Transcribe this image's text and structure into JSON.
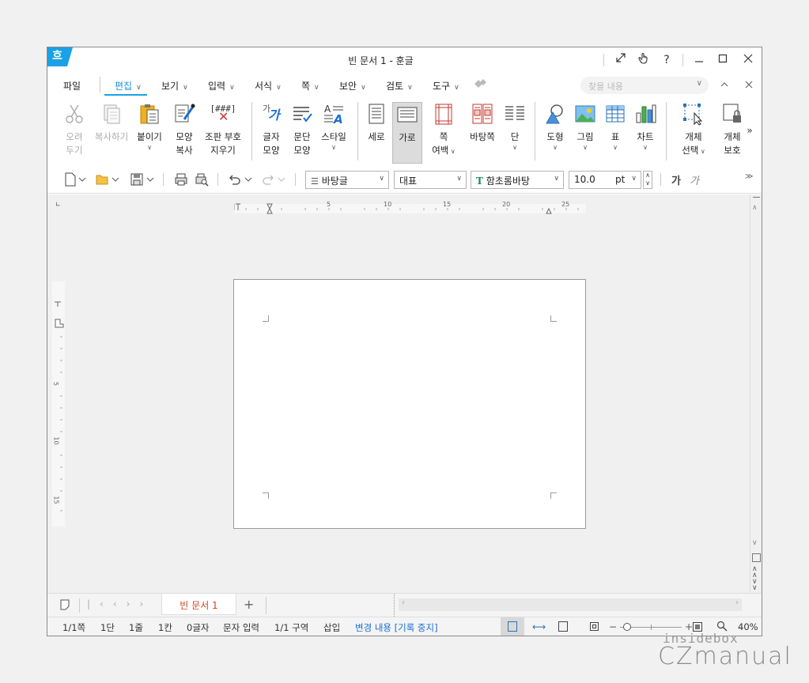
{
  "window": {
    "title": "빈 문서 1 - 훈글",
    "logo": "흐"
  },
  "menus": [
    {
      "label": "파일",
      "chev": false
    },
    {
      "label": "편집",
      "chev": true,
      "active": true
    },
    {
      "label": "보기",
      "chev": true
    },
    {
      "label": "입력",
      "chev": true
    },
    {
      "label": "서식",
      "chev": true
    },
    {
      "label": "쪽",
      "chev": true
    },
    {
      "label": "보안",
      "chev": true
    },
    {
      "label": "검토",
      "chev": true
    },
    {
      "label": "도구",
      "chev": true
    }
  ],
  "search": {
    "placeholder": "찾을 내용"
  },
  "ribbon": {
    "cut": [
      "오려",
      "두기"
    ],
    "copy": "복사하기",
    "paste": "붙이기",
    "format_copy": [
      "모양",
      "복사"
    ],
    "clear_codes": [
      "조판 부호",
      "지우기"
    ],
    "clear_codes_icon_text": "[###]",
    "char_shape": [
      "글자",
      "모양"
    ],
    "char_shape_icon_text": "가",
    "para_shape": [
      "문단",
      "모양"
    ],
    "style": "스타일",
    "portrait": "세로",
    "landscape": "가로",
    "margins": [
      "쪽",
      "여백"
    ],
    "background_page": "바탕쪽",
    "columns": "단",
    "shapes": "도형",
    "picture": "그림",
    "table": "표",
    "chart": "차트",
    "select_object": [
      "개체",
      "선택"
    ],
    "protect_object": [
      "개체",
      "보호"
    ]
  },
  "toolbar": {
    "style_select": "바탕글",
    "lang_select": "대표",
    "font_select": "함초롬바탕",
    "font_icon": "T",
    "size_value": "10.0",
    "size_unit": "pt",
    "bold_label": "가",
    "italic_label": "가"
  },
  "ruler": {
    "h_labels": [
      "5",
      "10",
      "15",
      "20",
      "25"
    ],
    "v_labels": [
      "5",
      "10",
      "15"
    ]
  },
  "tabs": {
    "doc_tab": "빈 문서 1",
    "add": "+"
  },
  "status": {
    "page": "1/1쪽",
    "column": "1단",
    "line": "1줄",
    "col": "1칸",
    "chars": "0글자",
    "input_mode": "문자 입력",
    "section": "1/1 구역",
    "insert": "삽입",
    "track": "변경 내용 [기록 중지]",
    "zoom": "40%"
  },
  "watermark": {
    "top": "insidebox",
    "bottom": "CZmanual"
  },
  "colors": {
    "accent": "#1aa1e6",
    "tab_text": "#d2451e",
    "link": "#1a6fd0"
  }
}
